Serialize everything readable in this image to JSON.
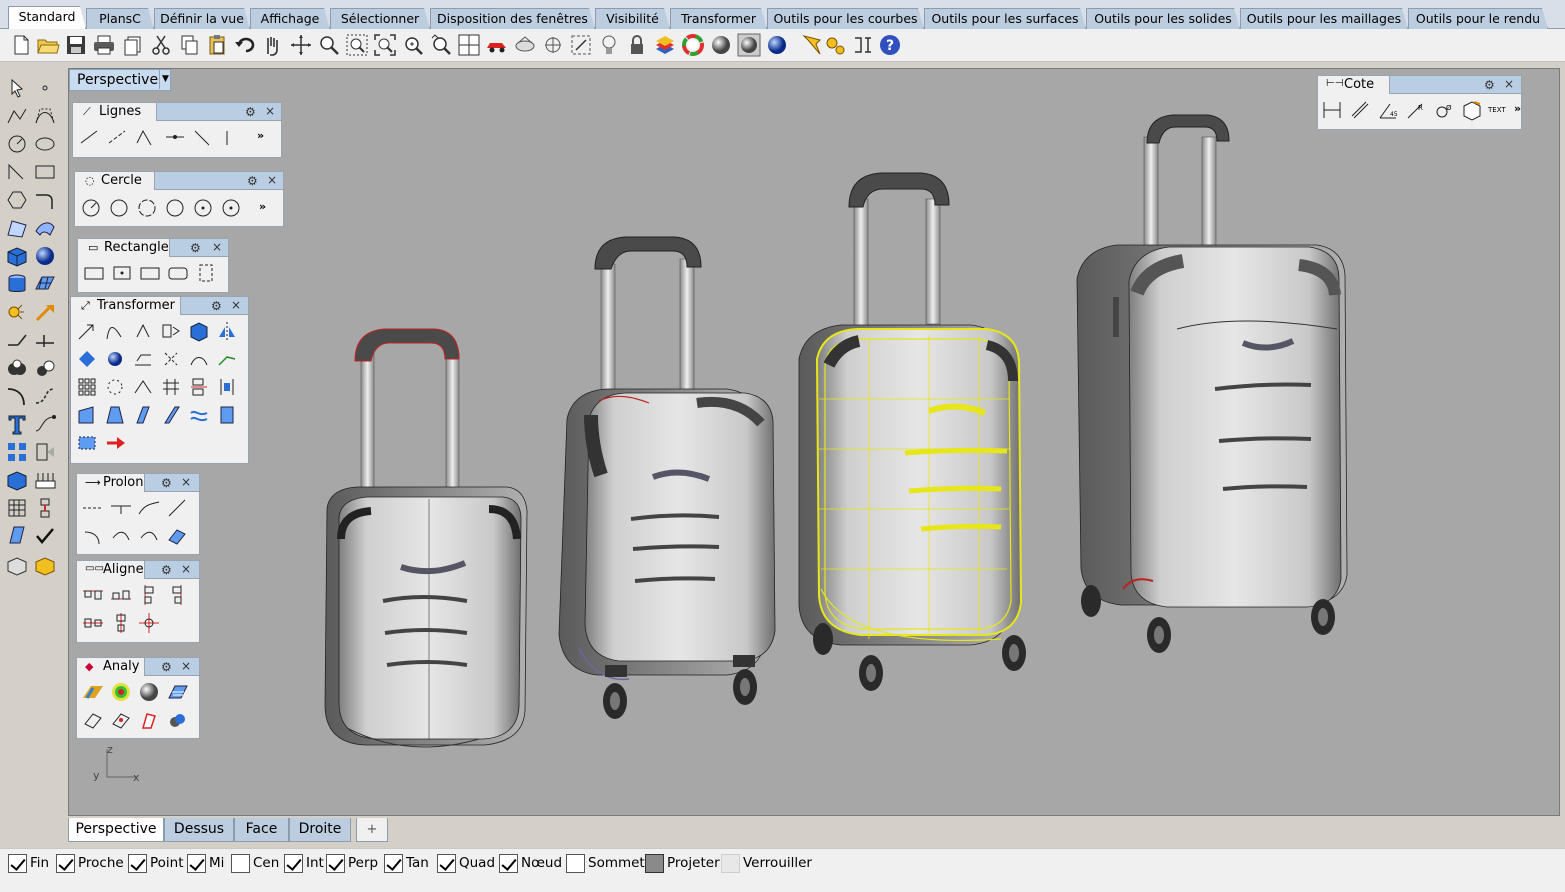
{
  "tabs": [
    {
      "label": "Standard",
      "active": true
    },
    {
      "label": "PlansC"
    },
    {
      "label": "Définir la vue"
    },
    {
      "label": "Affichage"
    },
    {
      "label": "Sélectionner"
    },
    {
      "label": "Disposition des fenêtres"
    },
    {
      "label": "Visibilité"
    },
    {
      "label": "Transformer"
    },
    {
      "label": "Outils pour les courbes"
    },
    {
      "label": "Outils pour les surfaces"
    },
    {
      "label": "Outils pour les solides"
    },
    {
      "label": "Outils pour les maillages"
    },
    {
      "label": "Outils pour le rendu"
    }
  ],
  "viewport": {
    "title": "Perspective",
    "axis_z": "z",
    "axis_y": "y",
    "axis_x": "x"
  },
  "panels": {
    "lignes": {
      "title": "Lignes",
      "more": "»"
    },
    "cercle": {
      "title": "Cercle",
      "more": "»"
    },
    "rectangle": {
      "title": "Rectangle"
    },
    "transformer": {
      "title": "Transformer"
    },
    "prolonger": {
      "title": "Prolon"
    },
    "aligner": {
      "title": "Aligne"
    },
    "analyser": {
      "title": "Analy"
    },
    "cote": {
      "title": "Cote",
      "more": "»",
      "text_icon": "TEXT"
    }
  },
  "viewport_tabs": [
    {
      "label": "Perspective",
      "active": true
    },
    {
      "label": "Dessus"
    },
    {
      "label": "Face"
    },
    {
      "label": "Droite"
    },
    {
      "label": "+"
    }
  ],
  "osnaps": [
    {
      "label": "Fin",
      "checked": true
    },
    {
      "label": "Proche",
      "checked": true
    },
    {
      "label": "Point",
      "checked": true
    },
    {
      "label": "Mi",
      "checked": true
    },
    {
      "label": "Cen",
      "checked": false
    },
    {
      "label": "Int",
      "checked": true
    },
    {
      "label": "Perp",
      "checked": true
    },
    {
      "label": "Tan",
      "checked": true
    },
    {
      "label": "Quad",
      "checked": true
    },
    {
      "label": "Nœud",
      "checked": true
    },
    {
      "label": "Sommet",
      "checked": false
    },
    {
      "label": "Projeter",
      "state": "filled"
    },
    {
      "label": "Verrouiller",
      "state": "disabled"
    }
  ],
  "colors": {
    "viewport_bg": "#a7a7a7",
    "selection": "#e6e61a",
    "edge_red": "#c0201e",
    "tab_bg": "#bccde0"
  }
}
